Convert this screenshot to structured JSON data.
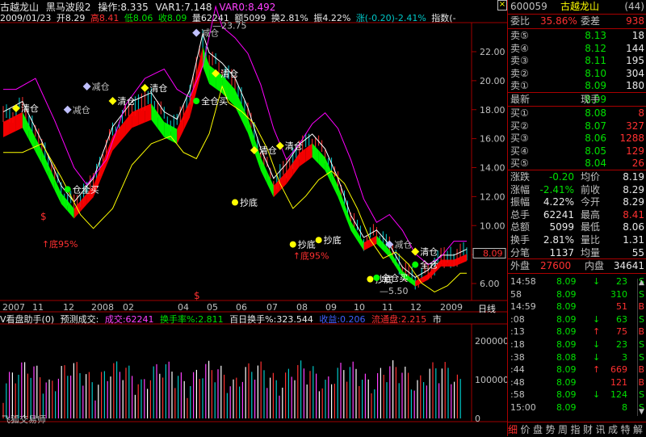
{
  "header": {
    "stock_name": "古越龙山",
    "indicator_name": "黑马波段2",
    "op_label": "操作:8.335",
    "var1": "VAR1:7.148",
    "var0": "VAR0:8.492",
    "close_btn": "×"
  },
  "info": {
    "date": "2009/01/23",
    "open": "开8.29",
    "high": "高8.41",
    "low": "低8.06",
    "close": "收8.09",
    "volume": "量62241",
    "amount": "额5099",
    "turnover": "换2.81%",
    "amplitude": "振4.22%",
    "change": "涨(-0.20)-2.41%",
    "index": "指数(-"
  },
  "price_labels": [
    "22.00",
    "20.00",
    "18.00",
    "16.00",
    "14.00",
    "12.00",
    "10.00",
    "8.00",
    "6.00"
  ],
  "price_values": [
    22,
    20,
    18,
    16,
    14,
    12,
    10,
    8,
    6
  ],
  "annotations": {
    "high_mark": "23.75",
    "low_mark": "5.50",
    "current_price": "8.09",
    "signals": [
      {
        "text": "清仓",
        "price": 18.1,
        "idx": 2
      },
      {
        "text": "减仓",
        "price": 19.6,
        "idx": 13
      },
      {
        "text": "减仓",
        "price": 18.0,
        "idx": 10
      },
      {
        "text": "清仓",
        "price": 18.6,
        "idx": 17
      },
      {
        "text": "清仓",
        "price": 19.5,
        "idx": 22
      },
      {
        "text": "减仓",
        "price": 23.3,
        "idx": 30
      },
      {
        "text": "清仓",
        "price": 20.5,
        "idx": 33
      },
      {
        "text": "全仓买",
        "price": 18.6,
        "idx": 30
      },
      {
        "text": "抄底",
        "price": 11.6,
        "idx": 36
      },
      {
        "text": "清仓",
        "price": 15.2,
        "idx": 39
      },
      {
        "text": "清仓",
        "price": 15.5,
        "idx": 43
      },
      {
        "text": "仓全买",
        "price": 12.5,
        "idx": 10
      },
      {
        "text": "抄底",
        "price": 8.7,
        "idx": 45
      },
      {
        "text": "抄底",
        "price": 9.0,
        "idx": 49
      },
      {
        "text": "抄底",
        "price": 6.3,
        "idx": 57
      },
      {
        "text": "全仓买",
        "price": 6.4,
        "idx": 58
      },
      {
        "text": "减仓",
        "price": 8.7,
        "idx": 60
      },
      {
        "text": "清仓",
        "price": 8.2,
        "idx": 64
      },
      {
        "text": "全仓",
        "price": 7.3,
        "idx": 64
      }
    ],
    "bottom_labels": [
      {
        "text": "底95%",
        "idx": 6,
        "price": 8.5
      },
      {
        "text": "底95%",
        "idx": 45,
        "price": 7.7
      }
    ]
  },
  "dates": [
    "2007",
    "11",
    "12",
    "2008",
    "02",
    "04",
    "05",
    "06",
    "07",
    "08",
    "09",
    "10",
    "11",
    "12",
    "2009"
  ],
  "period_label": "日线",
  "volume_bar": {
    "title": "V看盘助手(0)",
    "forecast": "预测成交:",
    "vol_val": "成交:62241",
    "turnover_rate": "换手率%:2.811",
    "hundred_day": "百日换手%:323.544",
    "income": "收益:0.206",
    "float_cap": "流通盘:2.215",
    "city": "市"
  },
  "vol_labels": [
    "200000",
    "100000",
    "0"
  ],
  "watermark": "飞狐交易师",
  "right_panel": {
    "code": "600059",
    "name": "古越龙山",
    "rank": "(44)",
    "weibi_label": "委比",
    "weibi_val": "35.86%",
    "weicha_label": "委差",
    "weicha_val": "938",
    "sells": [
      {
        "label": "卖⑤",
        "price": "8.13",
        "vol": "18"
      },
      {
        "label": "卖④",
        "price": "8.12",
        "vol": "144"
      },
      {
        "label": "卖③",
        "price": "8.11",
        "vol": "195"
      },
      {
        "label": "卖②",
        "price": "8.10",
        "vol": "304"
      },
      {
        "label": "卖①",
        "price": "8.09",
        "vol": "180"
      }
    ],
    "latest_label": "最新",
    "latest_val": "8.09",
    "xianshou_label": "现手",
    "buys": [
      {
        "label": "买①",
        "price": "8.08",
        "vol": "8"
      },
      {
        "label": "买②",
        "price": "8.07",
        "vol": "327"
      },
      {
        "label": "买③",
        "price": "8.06",
        "vol": "1288"
      },
      {
        "label": "买④",
        "price": "8.05",
        "vol": "129"
      },
      {
        "label": "买⑤",
        "price": "8.04",
        "vol": "26"
      }
    ],
    "stats": [
      {
        "l1": "涨跌",
        "v1": "-0.20",
        "l2": "均价",
        "v2": "8.19"
      },
      {
        "l1": "涨幅",
        "v1": "-2.41%",
        "l2": "前收",
        "v2": "8.29"
      },
      {
        "l1": "振幅",
        "v1": "4.22%",
        "l2": "今开",
        "v2": "8.29"
      },
      {
        "l1": "总手",
        "v1": "62241",
        "l2": "最高",
        "v2": "8.41"
      },
      {
        "l1": "总额",
        "v1": "5099",
        "l2": "最低",
        "v2": "8.06"
      },
      {
        "l1": "换手",
        "v1": "2.81%",
        "l2": "量比",
        "v2": "1.31"
      },
      {
        "l1": "分笔",
        "v1": "1137",
        "l2": "均量",
        "v2": "55"
      }
    ],
    "waipan_label": "外盘",
    "waipan_val": "27600",
    "neipan_label": "内盘",
    "neipan_val": "34641",
    "ticks": [
      {
        "t": "14:58",
        "p": "8.09",
        "a": "↓",
        "q": "23",
        "bs": "S"
      },
      {
        "t": "58",
        "p": "8.09",
        "a": "",
        "q": "310",
        "bs": "S"
      },
      {
        "t": "14:59",
        "p": "8.09",
        "a": "",
        "q": "51",
        "bs": "B"
      },
      {
        "t": ":08",
        "p": "8.09",
        "a": "↓",
        "q": "63",
        "bs": "S"
      },
      {
        "t": ":13",
        "p": "8.09",
        "a": "↑",
        "q": "75",
        "bs": "B"
      },
      {
        "t": ":18",
        "p": "8.09",
        "a": "↓",
        "q": "23",
        "bs": "S"
      },
      {
        "t": ":38",
        "p": "8.08",
        "a": "↓",
        "q": "3",
        "bs": "S"
      },
      {
        "t": ":44",
        "p": "8.09",
        "a": "↑",
        "q": "669",
        "bs": "B"
      },
      {
        "t": ":48",
        "p": "8.09",
        "a": "",
        "q": "121",
        "bs": "B"
      },
      {
        "t": ":58",
        "p": "8.09",
        "a": "↓",
        "q": "124",
        "bs": "S"
      },
      {
        "t": "15:00",
        "p": "8.09",
        "a": "",
        "q": "8",
        "bs": "S"
      }
    ],
    "bottom_tabs": [
      "细",
      "价",
      "盘",
      "势",
      "周",
      "指",
      "财",
      "讯",
      "成",
      "特",
      "解"
    ]
  },
  "colors": {
    "red": "#ff3030",
    "green": "#00e000",
    "yellow": "#ffff00",
    "cyan": "#00c8c8",
    "magenta": "#ff40ff",
    "grid": "#a00000"
  }
}
